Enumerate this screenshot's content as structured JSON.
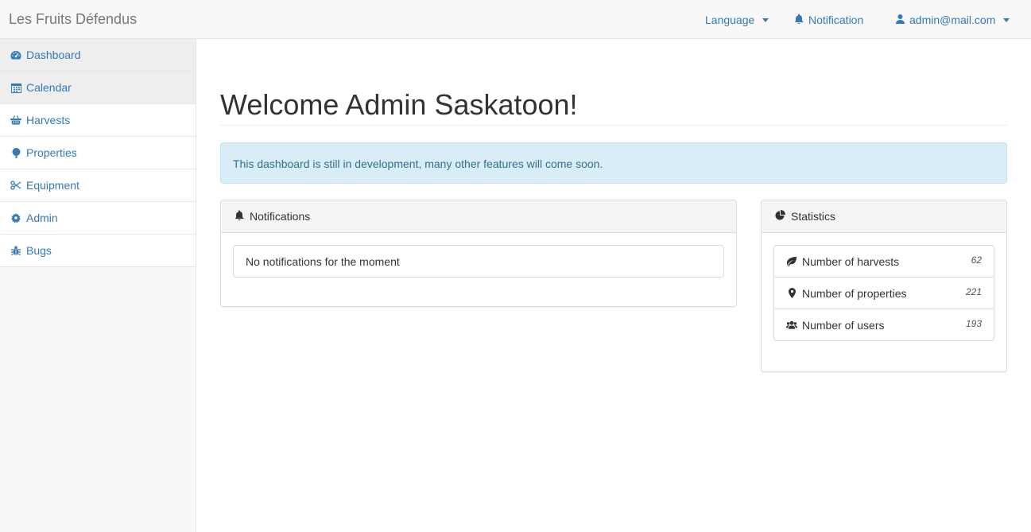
{
  "app": {
    "brand": "Les Fruits Défendus"
  },
  "navbar": {
    "language_label": "Language",
    "notification_label": "Notification",
    "user_label": "admin@mail.com"
  },
  "sidebar": {
    "items": [
      {
        "label": "Dashboard",
        "icon": "dashboard-icon"
      },
      {
        "label": "Calendar",
        "icon": "calendar-icon"
      },
      {
        "label": "Harvests",
        "icon": "basket-icon"
      },
      {
        "label": "Properties",
        "icon": "tree-icon"
      },
      {
        "label": "Equipment",
        "icon": "scissors-icon"
      },
      {
        "label": "Admin",
        "icon": "gear-icon"
      },
      {
        "label": "Bugs",
        "icon": "bug-icon"
      }
    ]
  },
  "main": {
    "title": "Welcome Admin Saskatoon!",
    "alert": "This dashboard is still in development, many other features will come soon.",
    "notifications": {
      "heading": "Notifications",
      "empty_text": "No notifications for the moment"
    },
    "statistics": {
      "heading": "Statistics",
      "rows": [
        {
          "label": "Number of harvests",
          "value": "62",
          "icon": "leaf-icon"
        },
        {
          "label": "Number of properties",
          "value": "221",
          "icon": "map-marker-icon"
        },
        {
          "label": "Number of users",
          "value": "193",
          "icon": "users-icon"
        }
      ]
    }
  },
  "colors": {
    "link": "#337ab7",
    "alert_bg": "#d9edf7",
    "alert_text": "#31708f"
  }
}
